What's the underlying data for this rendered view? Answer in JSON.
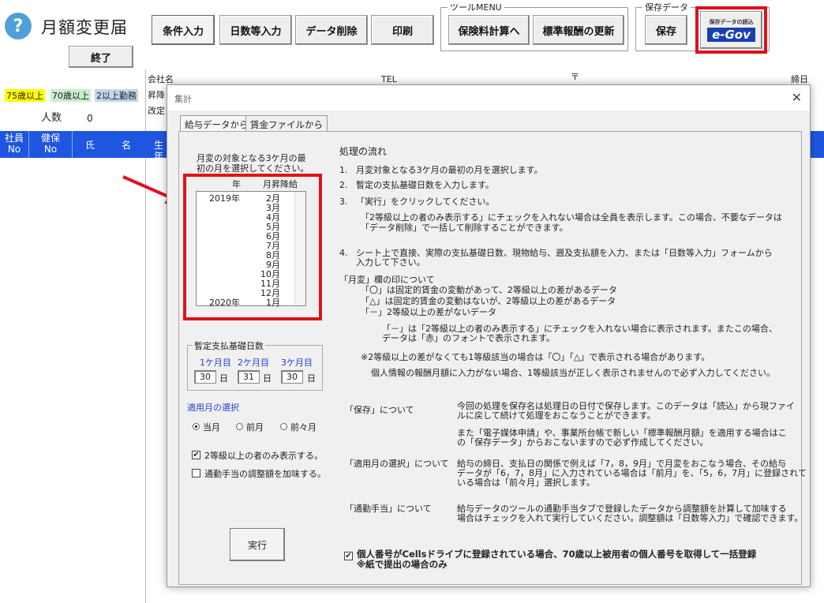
{
  "app": {
    "title": "月額変更届",
    "end_label": "終了",
    "help_icon": "?"
  },
  "toolbar": {
    "conditions": "条件入力",
    "days_input": "日数等入力",
    "delete_data": "データ削除",
    "print": "印刷",
    "tool_menu_label": "ツールMENU",
    "insurance_calc": "保険料計算へ",
    "standard_update": "標準報酬の更新",
    "save_group_label": "保存データ",
    "save": "保存",
    "egov_small": "保存データの読込",
    "egov_logo": "e-Gov"
  },
  "sheet": {
    "company_label": "会社名",
    "tel_label": "TEL",
    "postal_mark": "〒",
    "closing_label": "締日",
    "raise_label": "昇降",
    "revision_label": "改定",
    "tags": {
      "over75": "75歳以上",
      "over70": "70歳以上",
      "dual": "2以上勤務"
    },
    "tag_colors": {
      "over75": "#ffff00",
      "over70": "#c6efce",
      "dual": "#bdd7ee"
    },
    "headcount_label": "人数",
    "headcount_value": "0",
    "headers": {
      "emp_top": "社員",
      "emp_bottom": "No",
      "ins_top": "健保",
      "ins_bottom": "No",
      "last": "氏",
      "first": "名",
      "birth": "生年"
    }
  },
  "dialog": {
    "title": "集計",
    "close": "✕",
    "tabs": [
      "給与データから",
      "賃金ファイルから"
    ],
    "select_month_prompt": [
      "月変の対象となる3ケ月の最",
      "初の月を選択してください。"
    ],
    "list": {
      "col_year": "年",
      "col_month": "月昇降給",
      "rows": [
        {
          "year": "2019年",
          "month": "2月"
        },
        {
          "year": "",
          "month": "3月"
        },
        {
          "year": "",
          "month": "4月"
        },
        {
          "year": "",
          "month": "5月"
        },
        {
          "year": "",
          "month": "6月"
        },
        {
          "year": "",
          "month": "7月"
        },
        {
          "year": "",
          "month": "8月"
        },
        {
          "year": "",
          "month": "9月"
        },
        {
          "year": "",
          "month": "10月"
        },
        {
          "year": "",
          "month": "11月"
        },
        {
          "year": "",
          "month": "12月"
        },
        {
          "year": "2020年",
          "month": "1月"
        }
      ]
    },
    "days": {
      "legend": "暫定支払基礎日数",
      "m1": "1ケ月目",
      "m2": "2ケ月目",
      "m3": "3ケ月目",
      "v1": "30",
      "v2": "31",
      "v3": "30",
      "unit": "日"
    },
    "apply_month": {
      "label": "適用月の選択",
      "options": [
        "当月",
        "前月",
        "前々月"
      ],
      "selected": "当月"
    },
    "checks": {
      "grade2": "2等級以上の者のみ表示する。",
      "grade2_checked": true,
      "commute": "通勤手当の調整額を加味する。",
      "commute_checked": false
    },
    "exec": "実行",
    "flow": {
      "heading": "処理の流れ",
      "steps": [
        {
          "num": "1.",
          "text": "月変対象となる3ケ月の最初の月を選択します。"
        },
        {
          "num": "2.",
          "text": "暫定の支払基礎日数を入力します。"
        },
        {
          "num": "3.",
          "text": "「実行」をクリックしてください。"
        }
      ],
      "step3_note": [
        "「2等級以上の者のみ表示する」にチェックを入れない場合は全員を表示します。この場合、不要なデータは",
        "「データ削除」で一括して削除することができます。"
      ],
      "step4_num": "4.",
      "step4": [
        "シート上で直接、実際の支払基礎日数、現物給与、遡及支払額を入力、または「日数等入力」フォームから",
        "入力して下さい。"
      ],
      "mark_heading": "「月変」欄の印について",
      "marks": [
        "「〇」は固定的賃金の変動があって、2等級以上の差があるデータ",
        "「△」は固定的賃金の変動はないが、2等級以上の差があるデータ",
        "「－」2等級以上の差がないデータ"
      ],
      "dash_note": [
        "「－」は「2等級以上の者のみ表示する」にチェックを入れない場合に表示されます。またこの場合、",
        "データは「赤」のフォントで表示されます。"
      ],
      "note2": "※2等級以上の差がなくても1等級該当の場合は「〇」「△」で表示される場合があります。",
      "note3": "個人情報の報酬月額に入力がない場合、1等級該当が正しく表示されませんので必ず入力してください。"
    },
    "about": [
      {
        "title": "「保存」について",
        "lines": [
          "今回の処理を保存名は処理日の日付で保存します。このデータは「読込」から現ファイ",
          "ルに戻して続けて処理をおこなうことができます。"
        ],
        "extra": [
          "また「電子媒体申請」や、事業所台帳で新しい「標準報酬月額」を適用する場合はこ",
          "の「保存データ」からおこないますので必ず作成してください。"
        ]
      },
      {
        "title": "「適用月の選択」について",
        "lines": [
          "給与の締日、支払日の関係で例えば「7，8，9月」で月変をおこなう場合、その給与",
          "データが「6，7，8月」に入力されている場合は「前月」を、「5，6，7月」に登録されて",
          "いる場合は「前々月」選択します。"
        ]
      },
      {
        "title": "「通勤手当」について",
        "lines": [
          "給与データのツールの通勤手当タブで登録したデータから調整額を計算して加味する",
          "場合はチェックを入れて実行していください。調整額は「日数等入力」で確認できます。"
        ]
      }
    ],
    "mynumber": {
      "line1": "個人番号がCellsドライブに登録されている場合、70歳以上被用者の個人番号を取得して一括登録",
      "line2": "※紙で提出の場合のみ",
      "checked": true
    }
  },
  "colors": {
    "header_band": "#1f56e0",
    "highlight": "#e0111d",
    "egov_blue": "#1a3fb0"
  }
}
